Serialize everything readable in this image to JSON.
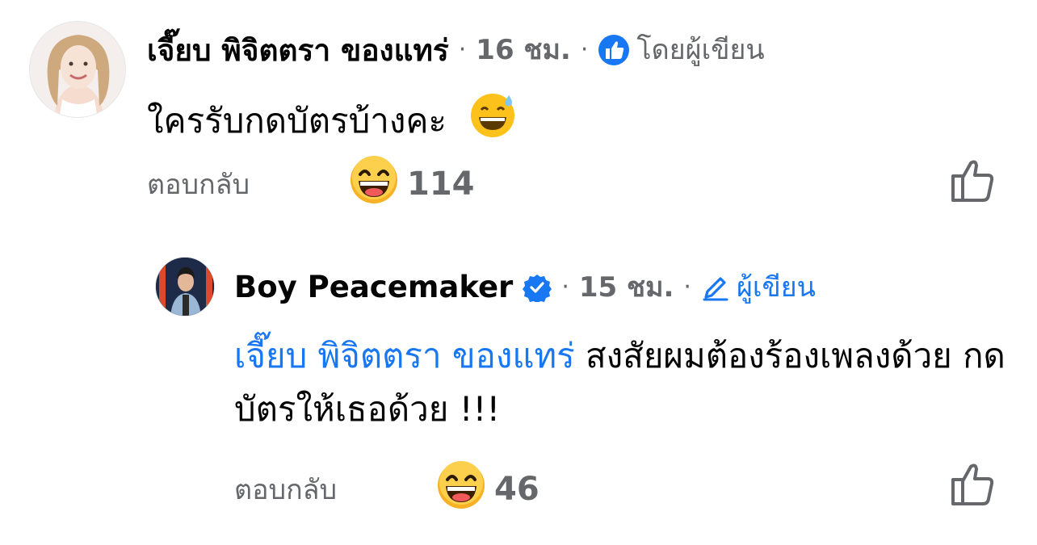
{
  "comments": [
    {
      "author": "เจี๊ยบ พิจิตตรา ของแทร่",
      "time": "16 ชม.",
      "separator": "·",
      "role_label": "โดยผู้เขียน",
      "text": "ใครรับกดบัตรบ้างคะ",
      "inline_emoji": "grinning-sweat-emoji",
      "reply_label": "ตอบกลับ",
      "reaction_emoji": "laughing-emoji",
      "reaction_count": "114"
    },
    {
      "author": "Boy Peacemaker",
      "time": "15 ชม.",
      "separator": "·",
      "role_label": "ผู้เขียน",
      "mention": "เจี๊ยบ พิจิตตรา ของแทร่",
      "text": " สงสัยผมต้องร้องเพลงด้วย กดบัตรให้เธอด้วย !!!",
      "reply_label": "ตอบกลับ",
      "reaction_emoji": "laughing-emoji",
      "reaction_count": "46"
    }
  ],
  "colors": {
    "link_blue": "#1877f2",
    "meta_gray": "#65676b",
    "text": "#050505"
  }
}
